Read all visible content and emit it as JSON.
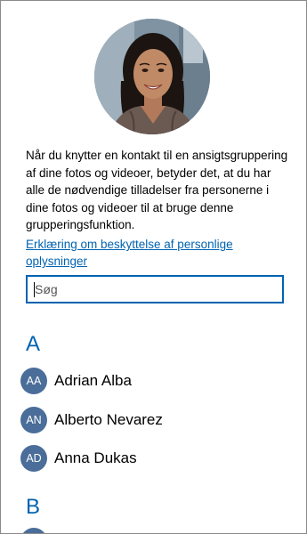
{
  "description": "Når du knytter en kontakt til en ansigtsgruppering af dine fotos og videoer, betyder det, at du har alle de nødvendige tilladelser fra personerne i dine fotos og videoer til at bruge denne grupperingsfunktion.",
  "privacy_link": "Erklæring om beskyttelse af personlige oplysninger",
  "search": {
    "placeholder": "Søg",
    "value": ""
  },
  "groups": [
    {
      "letter": "A",
      "contacts": [
        {
          "initials": "AA",
          "name": "Adrian Alba"
        },
        {
          "initials": "AN",
          "name": "Alberto Nevarez"
        },
        {
          "initials": "AD",
          "name": "Anna Dukas"
        }
      ]
    },
    {
      "letter": "B",
      "contacts": []
    }
  ],
  "colors": {
    "accent": "#0063b1",
    "avatar_bg": "#4a6d99",
    "text": "#000000"
  }
}
